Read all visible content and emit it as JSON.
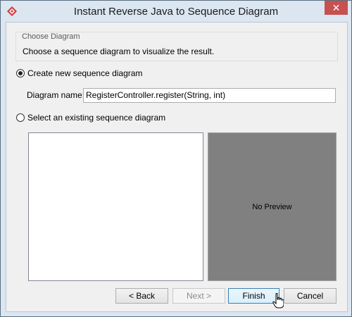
{
  "window": {
    "title": "Instant Reverse Java to Sequence Diagram",
    "close_glyph": "✕",
    "app_icon": "visual-paradigm-logo-icon",
    "accent_color": "#c75050"
  },
  "group": {
    "title": "Choose Diagram",
    "description": "Choose a sequence diagram to visualize the result."
  },
  "options": {
    "create_new": "Create new sequence diagram",
    "select_existing": "Select an existing sequence diagram",
    "selected": "create_new"
  },
  "diagram_name": {
    "label": "Diagram name:",
    "value": "RegisterController.register(String, int)"
  },
  "preview": {
    "text": "No Preview"
  },
  "buttons": {
    "back": "< Back",
    "next": "Next >",
    "finish": "Finish",
    "cancel": "Cancel"
  }
}
